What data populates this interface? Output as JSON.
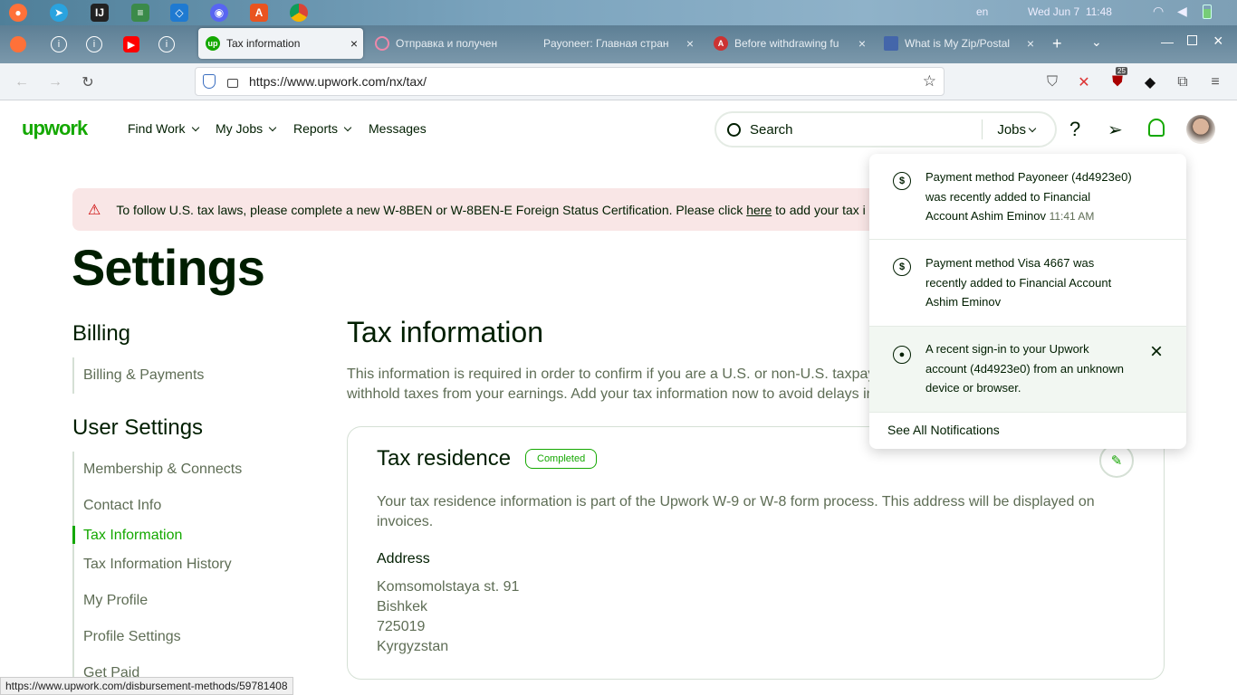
{
  "system_bar": {
    "lang": "en",
    "datetime": "Wed Jun 7  11:48"
  },
  "browser": {
    "tabs": [
      {
        "title": "Tax information",
        "active": true
      },
      {
        "title": "Отправка и получен",
        "active": false
      },
      {
        "title": "Payoneer: Главная стран",
        "active": false
      },
      {
        "title": "Before withdrawing fu",
        "active": false
      },
      {
        "title": "What is My Zip/Postal",
        "active": false
      }
    ],
    "url": "https://www.upwork.com/nx/tax/",
    "url_host": "upwork.com",
    "extension_badge": "25"
  },
  "header": {
    "logo": "upwork",
    "nav": [
      "Find Work",
      "My Jobs",
      "Reports",
      "Messages"
    ],
    "search_placeholder": "Search",
    "search_scope": "Jobs"
  },
  "banner": {
    "text_before": "To follow U.S. tax laws, please complete a new W-8BEN or W-8BEN-E Foreign Status Certification. Please click ",
    "link": "here",
    "text_after": " to add your tax i"
  },
  "page_title": "Settings",
  "sidebar": {
    "billing_heading": "Billing",
    "billing_items": [
      "Billing & Payments"
    ],
    "user_heading": "User Settings",
    "user_items": [
      "Membership & Connects",
      "Contact Info",
      "Tax Information",
      "Tax Information History",
      "My Profile",
      "Profile Settings",
      "Get Paid"
    ],
    "active_item": "Tax Information"
  },
  "main": {
    "title": "Tax information",
    "desc_line1": "This information is required in order to confirm if you are a U.S. or non-U.S. taxpaye",
    "desc_line2": "withhold taxes from your earnings. Add your tax information now to avoid delays in",
    "card": {
      "title": "Tax residence",
      "badge": "Completed",
      "desc_line1": "Your tax residence information is part of the Upwork W-9 or W-8 form process. This address will be displayed on",
      "desc_line2": "invoices.",
      "address_label": "Address",
      "address": [
        "Komsomolstaya st. 91",
        "Bishkek",
        "725019",
        "Kyrgyzstan"
      ]
    }
  },
  "notifications": {
    "items": [
      {
        "lines": [
          "Payment method Payoneer (4d4923e0)",
          "was recently added to Financial",
          "Account Ashim Eminov"
        ],
        "time": "11:41 AM",
        "icon": "dollar-icon"
      },
      {
        "lines": [
          "Payment method Visa 4667 was",
          "recently added to Financial Account",
          "Ashim Eminov"
        ],
        "time": "",
        "icon": "dollar-icon"
      },
      {
        "lines": [
          "A recent sign-in to your Upwork",
          "account (4d4923e0) from an unknown",
          "device or browser."
        ],
        "time": "",
        "icon": "user-circle-icon"
      }
    ],
    "see_all": "See All Notifications"
  },
  "status_url": "https://www.upwork.com/disbursement-methods/59781408",
  "colors": {
    "brand": "#14a800",
    "banner_bg": "#f9e6e6",
    "highlight_bg": "#f2f7f2"
  }
}
